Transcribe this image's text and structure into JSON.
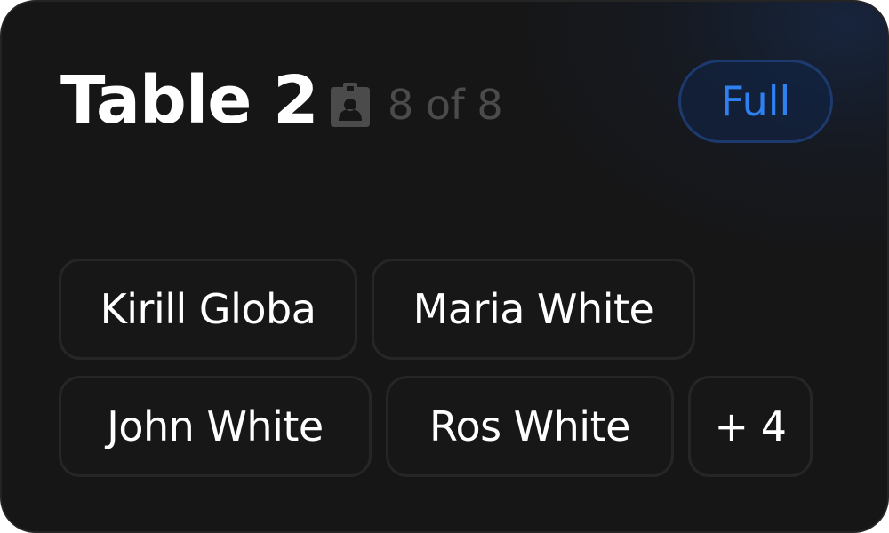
{
  "table": {
    "title": "Table 2",
    "seats_text": "8 of 8",
    "seats_icon": "clipboard-person-icon",
    "status": "Full",
    "colors": {
      "background": "#161616",
      "status_accent": "#2f80f0",
      "muted_text": "#4b4b4b"
    }
  },
  "guests": [
    {
      "name": "Kirill Globa"
    },
    {
      "name": "Maria White"
    },
    {
      "name": "John White"
    },
    {
      "name": "Ros White"
    }
  ],
  "more_label": "+ 4"
}
